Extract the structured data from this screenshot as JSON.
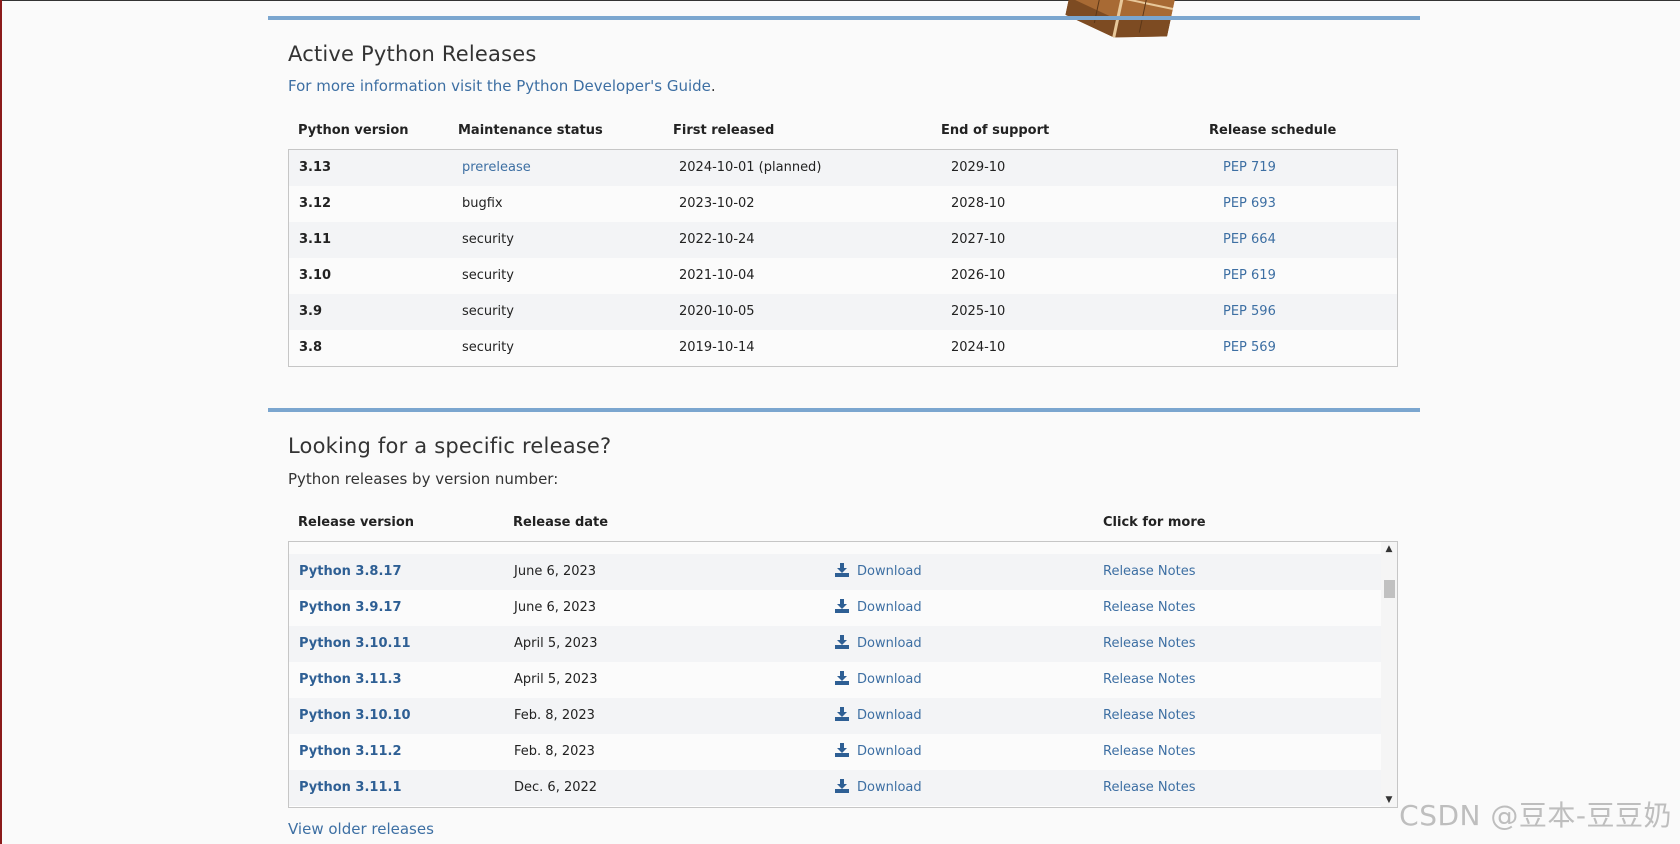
{
  "active_releases": {
    "title": "Active Python Releases",
    "info_link": "For more information visit the Python Developer's Guide",
    "info_suffix": ".",
    "headers": {
      "version": "Python version",
      "status": "Maintenance status",
      "first_released": "First released",
      "end_of_support": "End of support",
      "schedule": "Release schedule"
    },
    "rows": [
      {
        "version": "3.13",
        "status": "prerelease",
        "first_released": "2024-10-01 (planned)",
        "end_of_support": "2029-10",
        "schedule": "PEP 719"
      },
      {
        "version": "3.12",
        "status": "bugfix",
        "first_released": "2023-10-02",
        "end_of_support": "2028-10",
        "schedule": "PEP 693"
      },
      {
        "version": "3.11",
        "status": "security",
        "first_released": "2022-10-24",
        "end_of_support": "2027-10",
        "schedule": "PEP 664"
      },
      {
        "version": "3.10",
        "status": "security",
        "first_released": "2021-10-04",
        "end_of_support": "2026-10",
        "schedule": "PEP 619"
      },
      {
        "version": "3.9",
        "status": "security",
        "first_released": "2020-10-05",
        "end_of_support": "2025-10",
        "schedule": "PEP 596"
      },
      {
        "version": "3.8",
        "status": "security",
        "first_released": "2019-10-14",
        "end_of_support": "2024-10",
        "schedule": "PEP 569"
      }
    ]
  },
  "specific_release": {
    "title": "Looking for a specific release?",
    "subtitle": "Python releases by version number:",
    "headers": {
      "version": "Release version",
      "date": "Release date",
      "more": "Click for more"
    },
    "rows": [
      {
        "version": "Python 3.8.17",
        "date": "June 6, 2023",
        "download": "Download",
        "notes": "Release Notes"
      },
      {
        "version": "Python 3.9.17",
        "date": "June 6, 2023",
        "download": "Download",
        "notes": "Release Notes"
      },
      {
        "version": "Python 3.10.11",
        "date": "April 5, 2023",
        "download": "Download",
        "notes": "Release Notes"
      },
      {
        "version": "Python 3.11.3",
        "date": "April 5, 2023",
        "download": "Download",
        "notes": "Release Notes"
      },
      {
        "version": "Python 3.10.10",
        "date": "Feb. 8, 2023",
        "download": "Download",
        "notes": "Release Notes"
      },
      {
        "version": "Python 3.11.2",
        "date": "Feb. 8, 2023",
        "download": "Download",
        "notes": "Release Notes"
      },
      {
        "version": "Python 3.11.1",
        "date": "Dec. 6, 2022",
        "download": "Download",
        "notes": "Release Notes"
      }
    ],
    "older_link": "View older releases"
  },
  "watermark": "CSDN @豆本-豆豆奶",
  "icons": {
    "download": "download-icon",
    "scroll_up": "scroll-up-arrow-icon",
    "scroll_down": "scroll-down-arrow-icon"
  },
  "colors": {
    "link": "#3d6fa3",
    "rule": "#7ba6cf"
  }
}
